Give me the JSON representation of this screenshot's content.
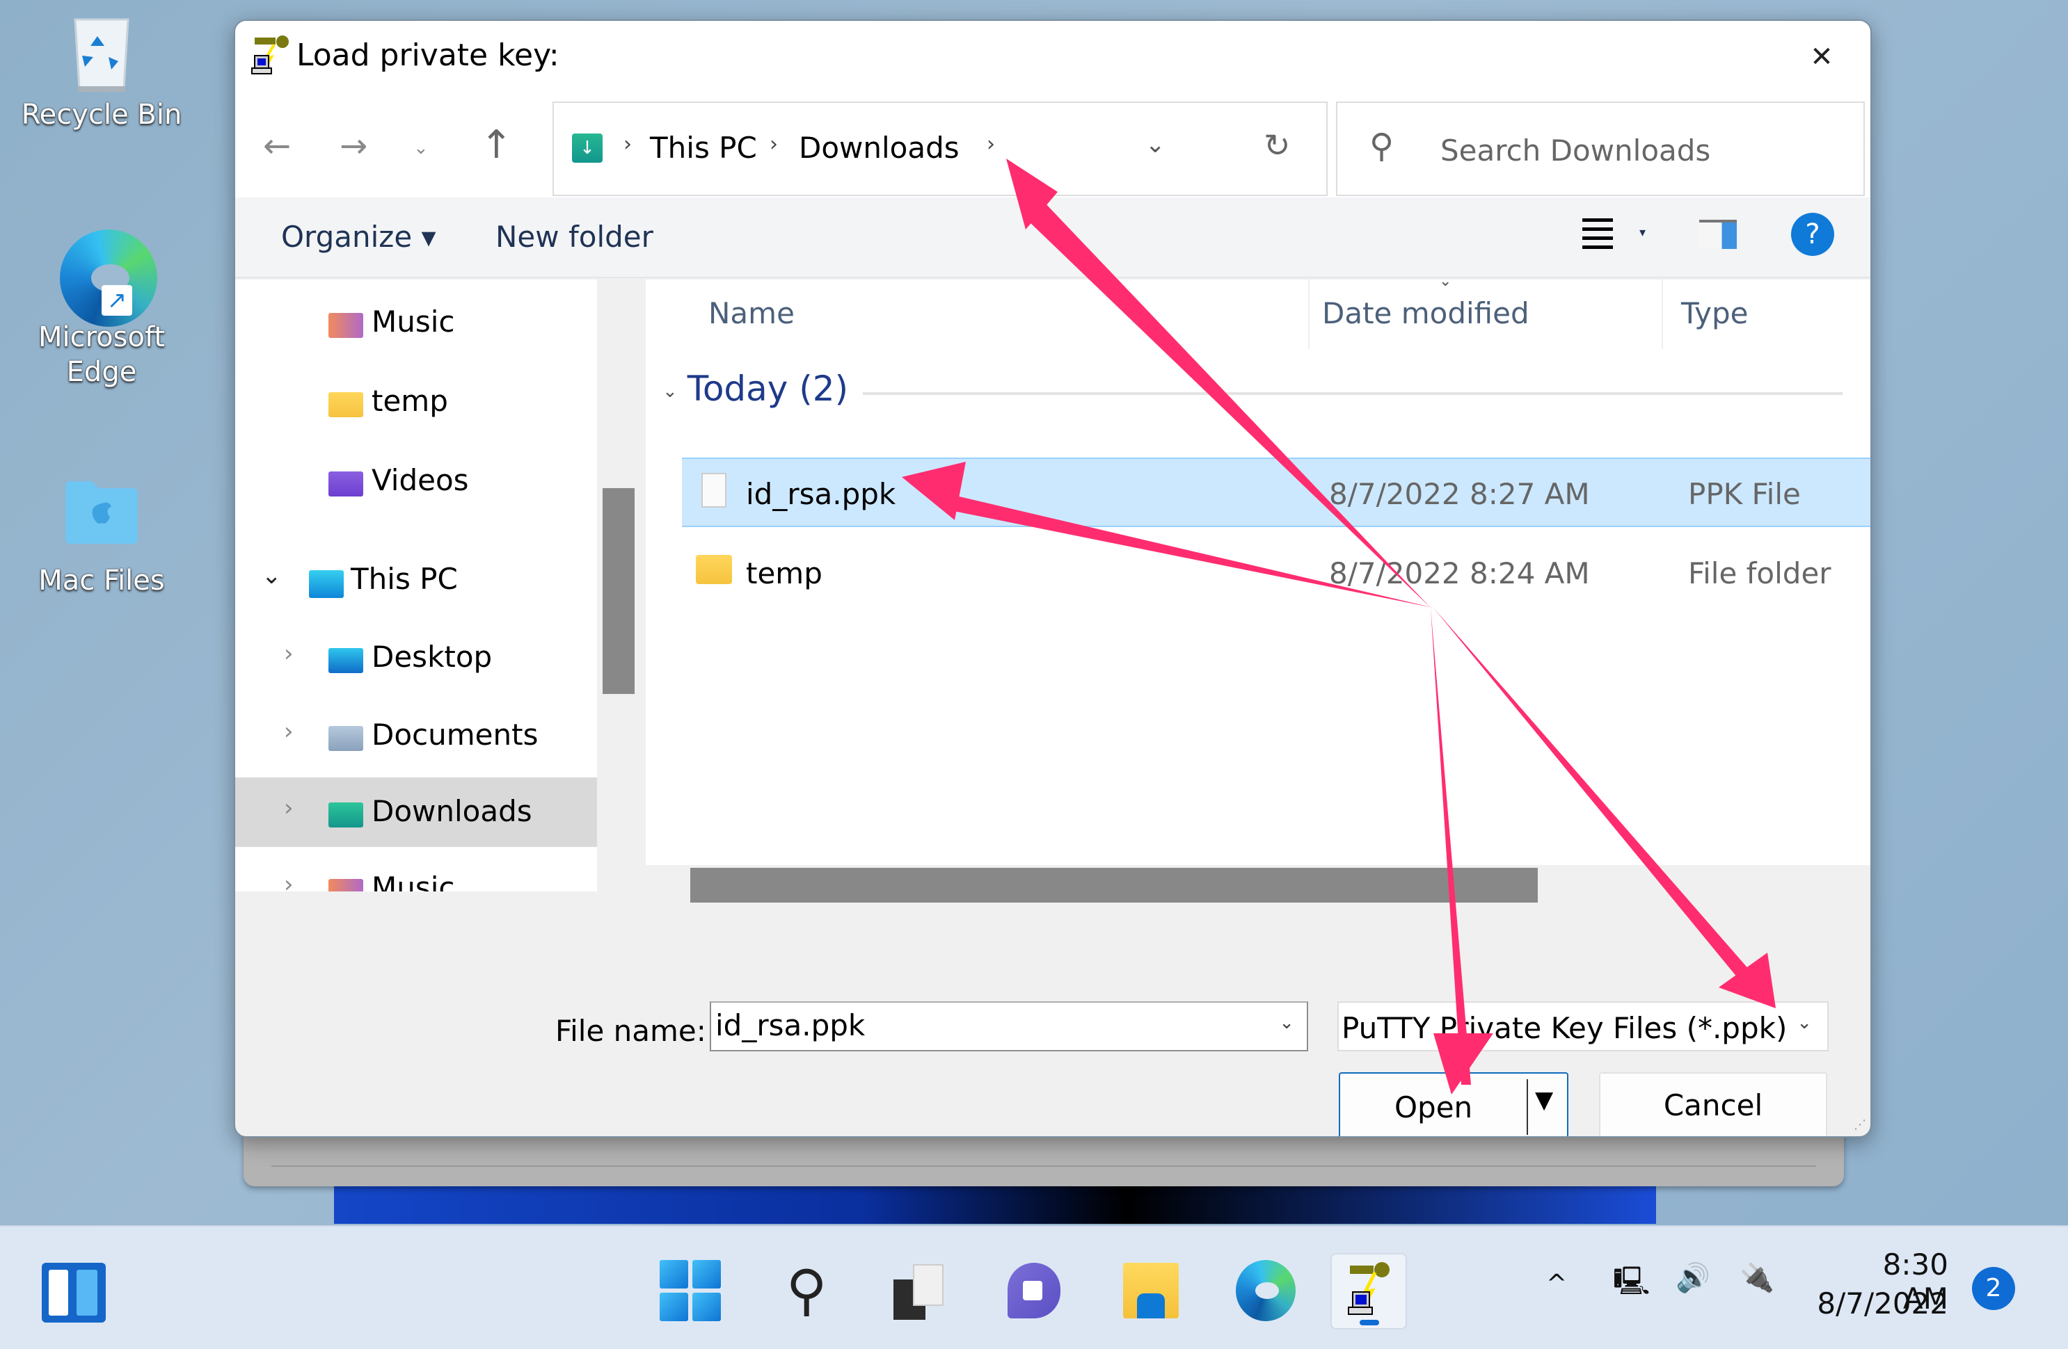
{
  "desktop": {
    "icons": [
      {
        "label": "Recycle Bin",
        "icon": "recycle-bin-icon"
      },
      {
        "label_line1": "Microsoft",
        "label_line2": "Edge",
        "icon": "edge-icon"
      },
      {
        "label": "Mac Files",
        "icon": "mac-folder-icon"
      }
    ]
  },
  "dialog": {
    "title": "Load private key:",
    "close_glyph": "✕",
    "nav": {
      "back_glyph": "←",
      "forward_glyph": "→",
      "recent_glyph": "⌄",
      "up_glyph": "↑"
    },
    "address": {
      "crumbs": [
        "This PC",
        "Downloads"
      ],
      "separator": "›",
      "dropdown_glyph": "⌄",
      "refresh_glyph": "↻"
    },
    "search": {
      "placeholder": "Search Downloads",
      "icon_glyph": "⚲"
    },
    "commands": {
      "organize": "Organize ▾",
      "new_folder": "New folder",
      "view_caret": "▾",
      "help_glyph": "?"
    },
    "nav_pane": {
      "items": [
        {
          "label": "Music",
          "icon": "music-folder-icon",
          "level": 2,
          "chevron": ""
        },
        {
          "label": "temp",
          "icon": "folder-icon",
          "level": 2,
          "chevron": ""
        },
        {
          "label": "Videos",
          "icon": "videos-folder-icon",
          "level": 2,
          "chevron": ""
        },
        {
          "label": "This PC",
          "icon": "this-pc-icon",
          "level": 1,
          "chevron": "⌄"
        },
        {
          "label": "Desktop",
          "icon": "desktop-folder-icon",
          "level": 2,
          "chevron": "›"
        },
        {
          "label": "Documents",
          "icon": "documents-folder-icon",
          "level": 2,
          "chevron": "›"
        },
        {
          "label": "Downloads",
          "icon": "downloads-folder-icon",
          "level": 2,
          "chevron": "›",
          "selected": true
        },
        {
          "label": "Music",
          "icon": "music-folder-icon",
          "level": 2,
          "chevron": "›"
        }
      ]
    },
    "file_list": {
      "columns": [
        "Name",
        "Date modified",
        "Type"
      ],
      "sort_indicator": "⌄",
      "group": {
        "label": "Today (2)",
        "toggle_glyph": "⌄"
      },
      "rows": [
        {
          "name": "id_rsa.ppk",
          "date": "8/7/2022 8:27 AM",
          "type": "PPK File",
          "kind": "file",
          "selected": true
        },
        {
          "name": "temp",
          "date": "8/7/2022 8:24 AM",
          "type": "File folder",
          "kind": "folder",
          "selected": false
        }
      ]
    },
    "footer": {
      "file_name_label": "File name:",
      "file_name_value": "id_rsa.ppk",
      "dropdown_glyph": "⌄",
      "filter_value": "PuTTY Private Key Files (*.ppk)",
      "open_label": "Open",
      "open_caret": "▼",
      "cancel_label": "Cancel",
      "grip_glyph": "⋰"
    }
  },
  "annotations": {
    "color": "#ff2d6f",
    "arrows_point_to": [
      "address-bar-downloads",
      "file-id_rsa.ppk",
      "open-button",
      "file-type-filter"
    ]
  },
  "taskbar": {
    "apps": [
      {
        "name": "start",
        "active": false
      },
      {
        "name": "search",
        "active": false,
        "glyph": "⚲"
      },
      {
        "name": "task-view",
        "active": false
      },
      {
        "name": "chat",
        "active": false
      },
      {
        "name": "file-explorer",
        "active": false
      },
      {
        "name": "edge",
        "active": false
      },
      {
        "name": "puttygen",
        "active": true
      }
    ],
    "tray": {
      "overflow_glyph": "^",
      "network_glyph": "🖳",
      "volume_glyph": "🔊",
      "battery_glyph": "🔌"
    },
    "clock": {
      "time": "8:30 AM",
      "date": "8/7/2022"
    },
    "notifications": "2"
  }
}
